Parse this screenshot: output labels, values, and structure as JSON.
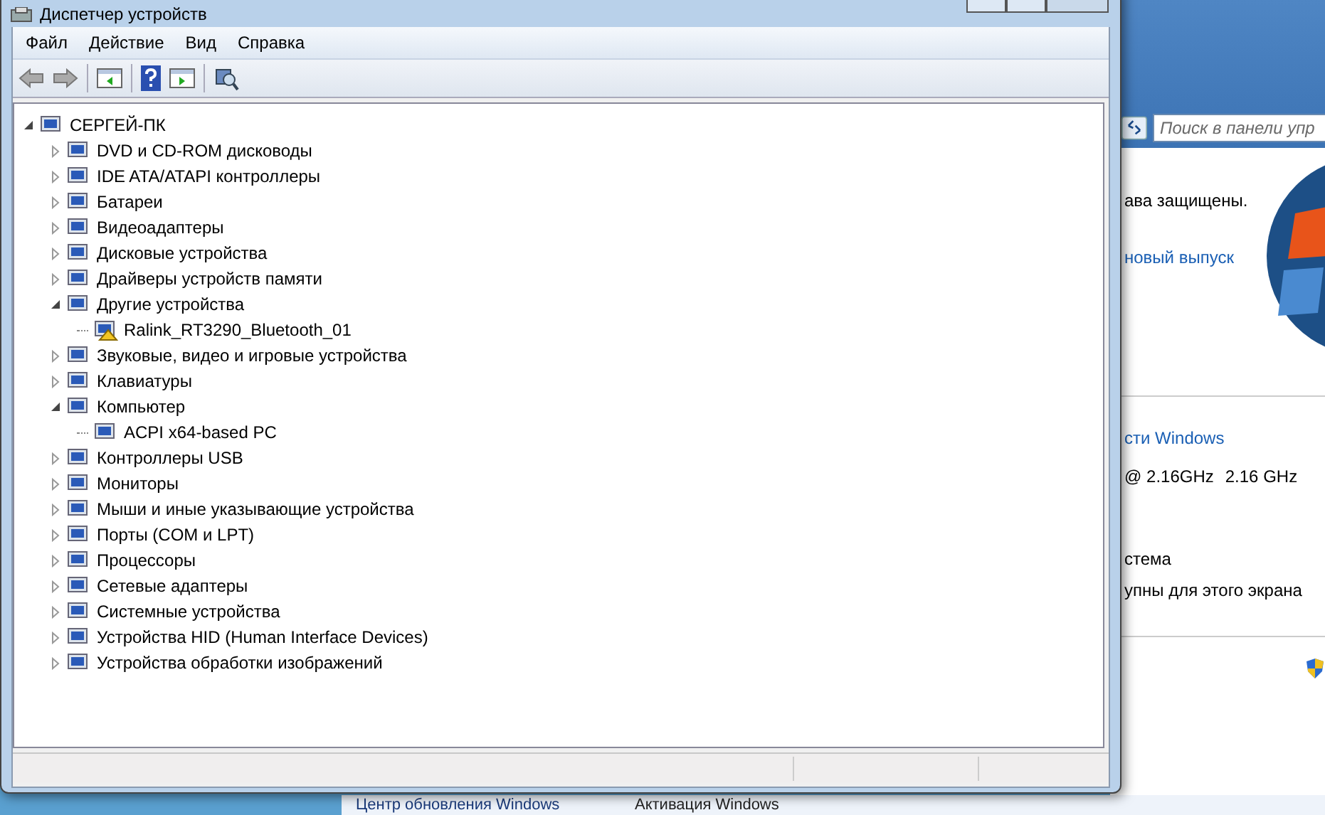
{
  "window": {
    "title": "Диспетчер устройств",
    "menu": [
      "Файл",
      "Действие",
      "Вид",
      "Справка"
    ],
    "tree": {
      "label": "СЕРГЕЙ-ПК",
      "expanded": true,
      "children": [
        {
          "label": "DVD и CD-ROM дисководы",
          "expanded": false
        },
        {
          "label": "IDE ATA/ATAPI контроллеры",
          "expanded": false
        },
        {
          "label": "Батареи",
          "expanded": false
        },
        {
          "label": "Видеоадаптеры",
          "expanded": false
        },
        {
          "label": "Дисковые устройства",
          "expanded": false
        },
        {
          "label": "Драйверы устройств памяти",
          "expanded": false
        },
        {
          "label": "Другие устройства",
          "expanded": true,
          "children": [
            {
              "label": "Ralink_RT3290_Bluetooth_01",
              "warning": true
            }
          ]
        },
        {
          "label": "Звуковые, видео и игровые устройства",
          "expanded": false
        },
        {
          "label": "Клавиатуры",
          "expanded": false
        },
        {
          "label": "Компьютер",
          "expanded": true,
          "children": [
            {
              "label": "ACPI x64-based PC",
              "warning": false
            }
          ]
        },
        {
          "label": "Контроллеры USB",
          "expanded": false
        },
        {
          "label": "Мониторы",
          "expanded": false
        },
        {
          "label": "Мыши и иные указывающие устройства",
          "expanded": false
        },
        {
          "label": "Порты (COM и LPT)",
          "expanded": false
        },
        {
          "label": "Процессоры",
          "expanded": false
        },
        {
          "label": "Сетевые адаптеры",
          "expanded": false
        },
        {
          "label": "Системные устройства",
          "expanded": false
        },
        {
          "label": "Устройства HID (Human Interface Devices)",
          "expanded": false
        },
        {
          "label": "Устройства обработки изображений",
          "expanded": false
        }
      ]
    }
  },
  "background_window": {
    "search": {
      "placeholder": "Поиск в панели упр"
    },
    "lines": [
      {
        "kind": "text",
        "text": "ава защищены."
      },
      {
        "kind": "link",
        "text": "новый выпуск"
      },
      {
        "kind": "link",
        "text": "сти Windows"
      },
      {
        "kind": "pair",
        "text": "@ 2.16GHz",
        "value": "2.16 GHz"
      },
      {
        "kind": "text",
        "text": "стема"
      },
      {
        "kind": "text",
        "text": "упны для этого экрана"
      }
    ],
    "footer": [
      "Центр обновления Windows",
      "Активация Windows"
    ]
  }
}
